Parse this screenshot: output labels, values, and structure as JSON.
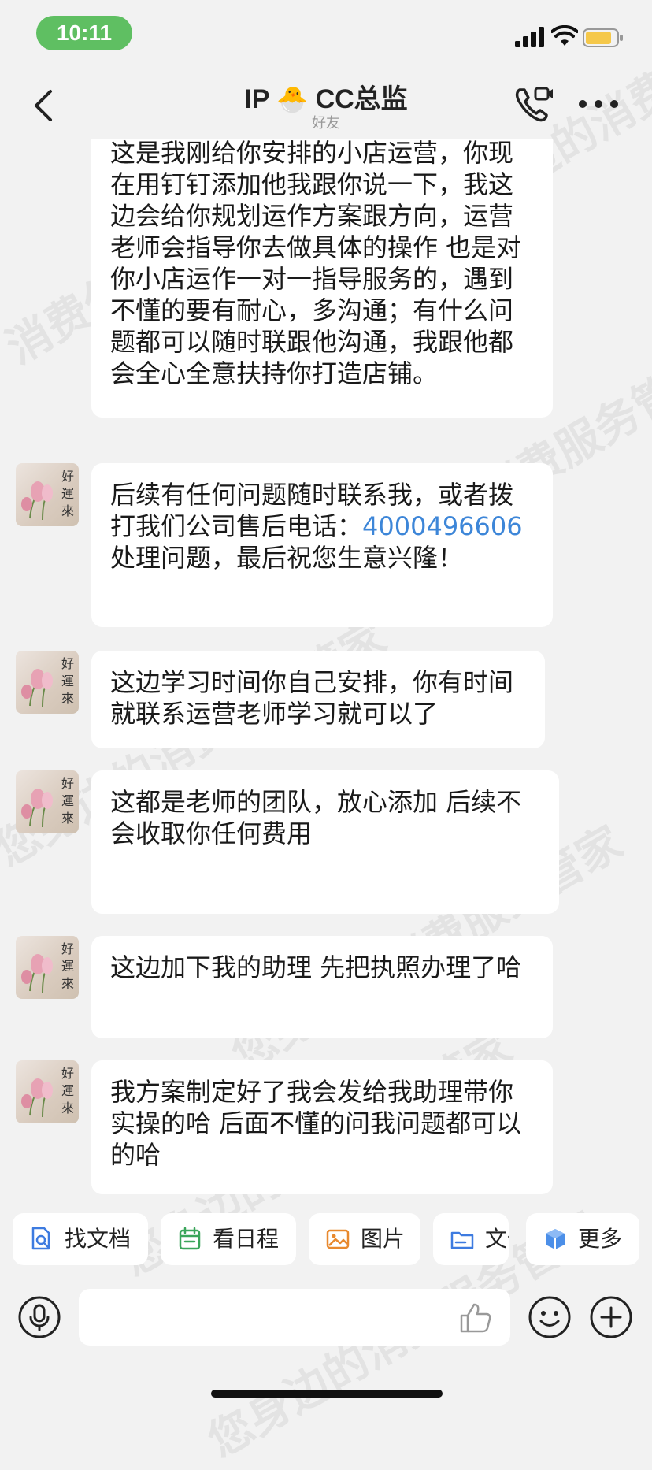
{
  "status_bar": {
    "time": "10:11"
  },
  "header": {
    "title_prefix": "IP",
    "title_emoji": "🐣",
    "title_suffix": "CC总监",
    "subtitle": "好友"
  },
  "watermark": "您身边的消费服务管家",
  "messages": [
    {
      "text": "这是我刚给你安排的小店运营，你现在用钉钉添加他我跟你说一下，我这边会给你规划运作方案跟方向，运营老师会指导你去做具体的操作  也是对你小店运作一对一指导服务的，遇到不懂的要有耐心，多沟通；有什么问题都可以随时联跟他沟通，我跟他都会全心全意扶持你打造店铺。"
    },
    {
      "text_before": "后续有任何问题随时联系我，或者拨打我们公司售后电话：",
      "phone": "4000496606",
      "text_after": " 处理问题，最后祝您生意兴隆！"
    },
    {
      "text": "这边学习时间你自己安排，你有时间就联系运营老师学习就可以了"
    },
    {
      "text": "这都是老师的团队，放心添加  后续不会收取你任何费用"
    },
    {
      "text": "这边加下我的助理 先把执照办理了哈"
    },
    {
      "text": "我方案制定好了我会发给我助理带你实操的哈 后面不懂的问我问题都可以的哈"
    }
  ],
  "avatar_text": "好運來",
  "quick_actions": [
    {
      "label": "找文档",
      "icon": "doc-search-icon",
      "color": "#3d7be0"
    },
    {
      "label": "看日程",
      "icon": "calendar-icon",
      "color": "#3aa55a"
    },
    {
      "label": "图片",
      "icon": "image-icon",
      "color": "#e8892e"
    },
    {
      "label": "文件",
      "icon": "folder-icon",
      "color": "#3d7be0"
    },
    {
      "label": "更多",
      "icon": "more-cube-icon",
      "color": "#3d7be0"
    }
  ],
  "input": {
    "placeholder": ""
  }
}
